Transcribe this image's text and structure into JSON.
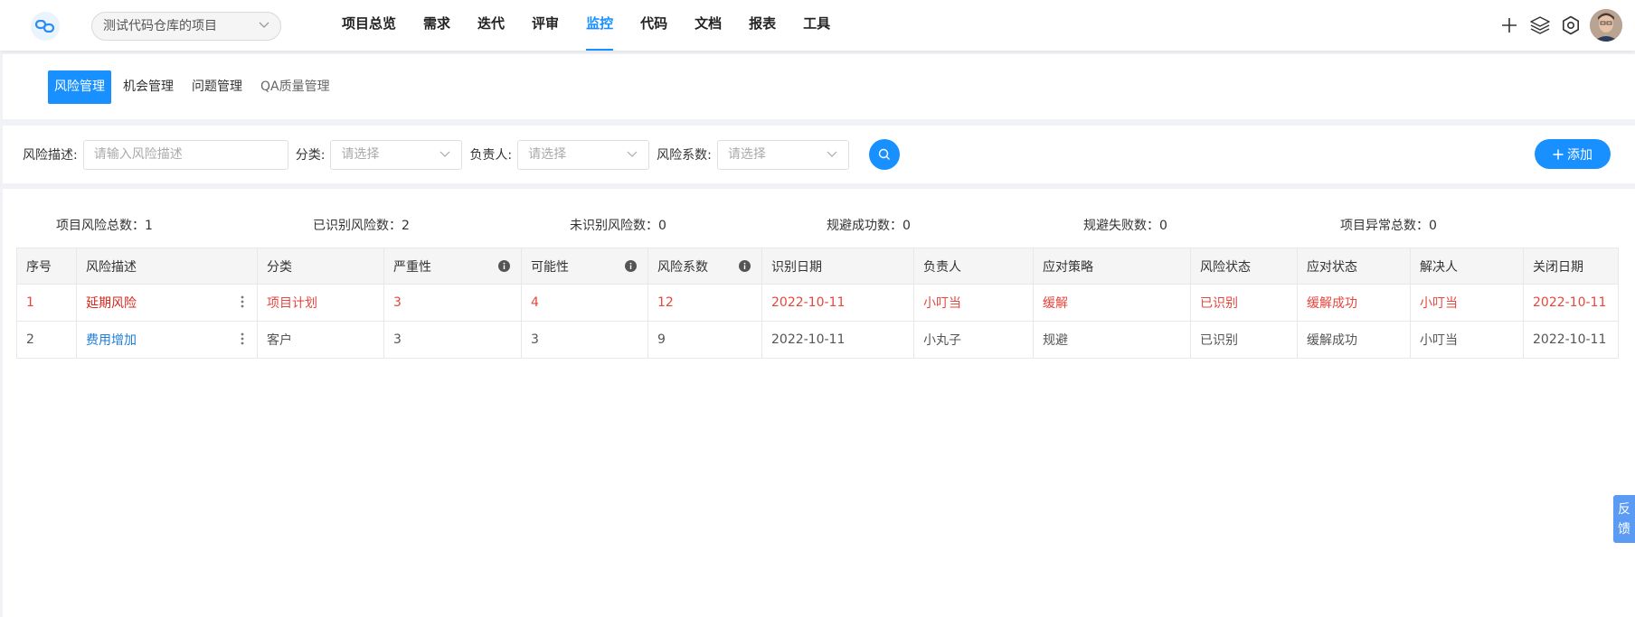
{
  "header": {
    "project_name": "测试代码仓库的项目",
    "nav": [
      {
        "label": "项目总览",
        "active": false
      },
      {
        "label": "需求",
        "active": false
      },
      {
        "label": "迭代",
        "active": false
      },
      {
        "label": "评审",
        "active": false
      },
      {
        "label": "监控",
        "active": true
      },
      {
        "label": "代码",
        "active": false
      },
      {
        "label": "文档",
        "active": false
      },
      {
        "label": "报表",
        "active": false
      },
      {
        "label": "工具",
        "active": false
      }
    ],
    "icons": [
      "plus-icon",
      "layers-icon",
      "settings-icon",
      "avatar"
    ]
  },
  "subtabs": [
    {
      "label": "风险管理",
      "active": true
    },
    {
      "label": "机会管理",
      "active": false
    },
    {
      "label": "问题管理",
      "active": false
    },
    {
      "label": "QA质量管理",
      "active": false
    }
  ],
  "filters": {
    "desc_label": "风险描述:",
    "desc_placeholder": "请输入风险描述",
    "category_label": "分类:",
    "category_placeholder": "请选择",
    "owner_label": "负责人:",
    "owner_placeholder": "请选择",
    "coef_label": "风险系数:",
    "coef_placeholder": "请选择",
    "add_label": "添加"
  },
  "stats": [
    "项目风险总数：1",
    "已识别风险数：2",
    "未识别风险数：0",
    "规避成功数：0",
    "规避失败数：0",
    "项目异常总数：0"
  ],
  "table": {
    "columns": [
      "序号",
      "风险描述",
      "分类",
      "严重性",
      "可能性",
      "风险系数",
      "识别日期",
      "负责人",
      "应对策略",
      "风险状态",
      "应对状态",
      "解决人",
      "关闭日期"
    ],
    "rows": [
      [
        "1",
        "延期风险",
        "项目计划",
        "3",
        "4",
        "12",
        "2022-10-11",
        "小叮当",
        "缓解",
        "已识别",
        "缓解成功",
        "小叮当",
        "2022-10-11"
      ],
      [
        "2",
        "费用增加",
        "客户",
        "3",
        "3",
        "9",
        "2022-10-11",
        "小丸子",
        "规避",
        "已识别",
        "缓解成功",
        "小叮当",
        "2022-10-11"
      ]
    ]
  },
  "feedback": [
    "反",
    "馈"
  ],
  "colors": {
    "accent": "#1890ff",
    "risk_red": "#e8453c",
    "link_blue": "#1f7ed6"
  }
}
